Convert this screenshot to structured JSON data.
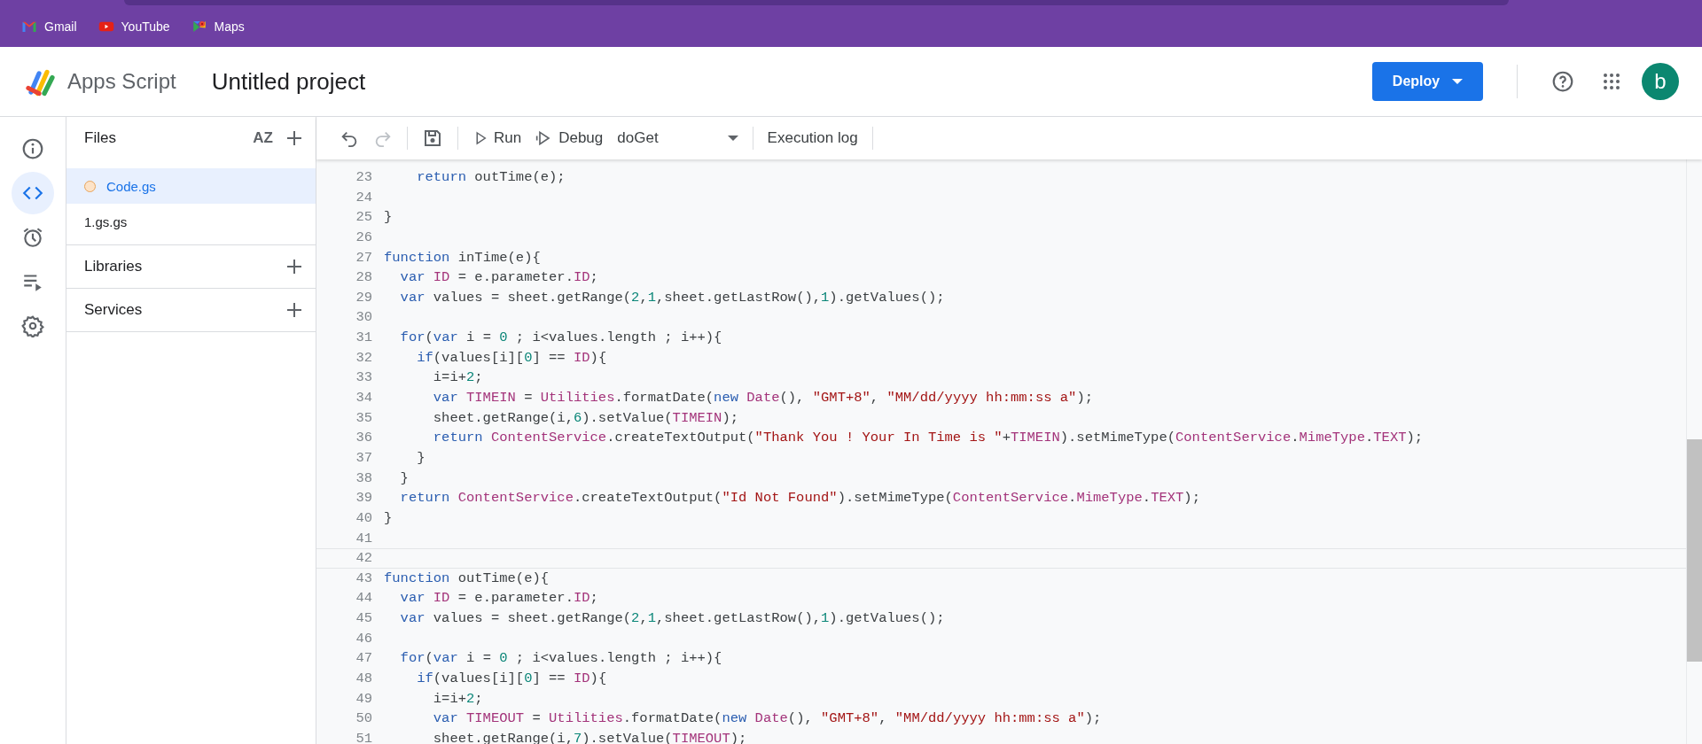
{
  "bookmarks": [
    {
      "kind": "gmail",
      "label": "Gmail"
    },
    {
      "kind": "youtube",
      "label": "YouTube"
    },
    {
      "kind": "maps",
      "label": "Maps"
    }
  ],
  "header": {
    "app_name": "Apps Script",
    "project_title": "Untitled project",
    "deploy_label": "Deploy",
    "avatar_letter": "b"
  },
  "rail": [
    {
      "kind": "info",
      "selected": false
    },
    {
      "kind": "editor",
      "selected": true
    },
    {
      "kind": "triggers",
      "selected": false
    },
    {
      "kind": "executions",
      "selected": false
    },
    {
      "kind": "settings",
      "selected": false
    }
  ],
  "files": {
    "title": "Files",
    "sort_label": "AZ",
    "items": [
      {
        "name": "Code.gs",
        "selected": true,
        "unsaved": true
      },
      {
        "name": "1.gs.gs",
        "selected": false,
        "unsaved": false
      }
    ]
  },
  "sections": [
    {
      "title": "Libraries"
    },
    {
      "title": "Services"
    }
  ],
  "toolbar": {
    "undo_disabled": false,
    "redo_disabled": true,
    "run_label": "Run",
    "debug_label": "Debug",
    "function_name": "doGet",
    "log_label": "Execution log"
  },
  "code_lines": [
    {
      "num": "23",
      "current": false,
      "tokens": [
        {
          "kind": "keyword",
          "text": "    return"
        },
        {
          "kind": "plain",
          "text": " outTime(e);"
        }
      ]
    },
    {
      "num": "24",
      "current": false
    },
    {
      "num": "25",
      "current": false,
      "tokens": [
        {
          "kind": "plain",
          "text": "}"
        }
      ]
    },
    {
      "num": "26",
      "current": false
    },
    {
      "num": "27",
      "current": false,
      "tokens": [
        {
          "kind": "keyword",
          "text": "function"
        },
        {
          "kind": "plain",
          "text": " inTime(e){"
        }
      ]
    },
    {
      "num": "28",
      "current": false,
      "tokens": [
        {
          "kind": "keyword",
          "text": "  var "
        },
        {
          "kind": "variable",
          "text": "ID"
        },
        {
          "kind": "plain",
          "text": " = e.parameter."
        },
        {
          "kind": "variable",
          "text": "ID"
        },
        {
          "kind": "plain",
          "text": ";"
        }
      ]
    },
    {
      "num": "29",
      "current": false,
      "tokens": [
        {
          "kind": "keyword",
          "text": "  var"
        },
        {
          "kind": "plain",
          "text": " values = sheet.getRange("
        },
        {
          "kind": "number",
          "text": "2"
        },
        {
          "kind": "plain",
          "text": ","
        },
        {
          "kind": "number",
          "text": "1"
        },
        {
          "kind": "plain",
          "text": ",sheet.getLastRow(),"
        },
        {
          "kind": "number",
          "text": "1"
        },
        {
          "kind": "plain",
          "text": ").getValues();"
        }
      ]
    },
    {
      "num": "30",
      "current": false
    },
    {
      "num": "31",
      "current": false,
      "tokens": [
        {
          "kind": "keyword",
          "text": "  for"
        },
        {
          "kind": "plain",
          "text": "("
        },
        {
          "kind": "keyword",
          "text": "var"
        },
        {
          "kind": "plain",
          "text": " i = "
        },
        {
          "kind": "number",
          "text": "0"
        },
        {
          "kind": "plain",
          "text": " ; i<values.length ; i++){"
        }
      ]
    },
    {
      "num": "32",
      "current": false,
      "tokens": [
        {
          "kind": "keyword",
          "text": "    if"
        },
        {
          "kind": "plain",
          "text": "(values[i]["
        },
        {
          "kind": "number",
          "text": "0"
        },
        {
          "kind": "plain",
          "text": "] == "
        },
        {
          "kind": "variable",
          "text": "ID"
        },
        {
          "kind": "plain",
          "text": "){"
        }
      ]
    },
    {
      "num": "33",
      "current": false,
      "tokens": [
        {
          "kind": "plain",
          "text": "      i=i+"
        },
        {
          "kind": "number",
          "text": "2"
        },
        {
          "kind": "plain",
          "text": ";"
        }
      ]
    },
    {
      "num": "34",
      "current": false,
      "tokens": [
        {
          "kind": "keyword",
          "text": "      var "
        },
        {
          "kind": "variable",
          "text": "TIMEIN"
        },
        {
          "kind": "plain",
          "text": " = "
        },
        {
          "kind": "variable",
          "text": "Utilities"
        },
        {
          "kind": "plain",
          "text": ".formatDate("
        },
        {
          "kind": "keyword",
          "text": "new "
        },
        {
          "kind": "variable",
          "text": "Date"
        },
        {
          "kind": "plain",
          "text": "(), "
        },
        {
          "kind": "string",
          "text": "\"GMT+8\""
        },
        {
          "kind": "plain",
          "text": ", "
        },
        {
          "kind": "string",
          "text": "\"MM/dd/yyyy hh:mm:ss a\""
        },
        {
          "kind": "plain",
          "text": ");"
        }
      ]
    },
    {
      "num": "35",
      "current": false,
      "tokens": [
        {
          "kind": "plain",
          "text": "      sheet.getRange(i,"
        },
        {
          "kind": "number",
          "text": "6"
        },
        {
          "kind": "plain",
          "text": ").setValue("
        },
        {
          "kind": "variable",
          "text": "TIMEIN"
        },
        {
          "kind": "plain",
          "text": ");"
        }
      ]
    },
    {
      "num": "36",
      "current": false,
      "tokens": [
        {
          "kind": "keyword",
          "text": "      return "
        },
        {
          "kind": "variable",
          "text": "ContentService"
        },
        {
          "kind": "plain",
          "text": ".createTextOutput("
        },
        {
          "kind": "string",
          "text": "\"Thank You ! Your In Time is \""
        },
        {
          "kind": "plain",
          "text": "+"
        },
        {
          "kind": "variable",
          "text": "TIMEIN"
        },
        {
          "kind": "plain",
          "text": ").setMimeType("
        },
        {
          "kind": "variable",
          "text": "ContentService"
        },
        {
          "kind": "plain",
          "text": "."
        },
        {
          "kind": "variable",
          "text": "MimeType"
        },
        {
          "kind": "plain",
          "text": "."
        },
        {
          "kind": "variable",
          "text": "TEXT"
        },
        {
          "kind": "plain",
          "text": ");"
        }
      ]
    },
    {
      "num": "37",
      "current": false,
      "tokens": [
        {
          "kind": "plain",
          "text": "    }"
        }
      ]
    },
    {
      "num": "38",
      "current": false,
      "tokens": [
        {
          "kind": "plain",
          "text": "  }"
        }
      ]
    },
    {
      "num": "39",
      "current": false,
      "tokens": [
        {
          "kind": "keyword",
          "text": "  return "
        },
        {
          "kind": "variable",
          "text": "ContentService"
        },
        {
          "kind": "plain",
          "text": ".createTextOutput("
        },
        {
          "kind": "string",
          "text": "\"Id Not Found\""
        },
        {
          "kind": "plain",
          "text": ").setMimeType("
        },
        {
          "kind": "variable",
          "text": "ContentService"
        },
        {
          "kind": "plain",
          "text": "."
        },
        {
          "kind": "variable",
          "text": "MimeType"
        },
        {
          "kind": "plain",
          "text": "."
        },
        {
          "kind": "variable",
          "text": "TEXT"
        },
        {
          "kind": "plain",
          "text": ");"
        }
      ]
    },
    {
      "num": "40",
      "current": false,
      "tokens": [
        {
          "kind": "plain",
          "text": "}"
        }
      ]
    },
    {
      "num": "41",
      "current": false
    },
    {
      "num": "42",
      "current": true
    },
    {
      "num": "43",
      "current": false,
      "tokens": [
        {
          "kind": "keyword",
          "text": "function"
        },
        {
          "kind": "plain",
          "text": " outTime(e){"
        }
      ]
    },
    {
      "num": "44",
      "current": false,
      "tokens": [
        {
          "kind": "keyword",
          "text": "  var "
        },
        {
          "kind": "variable",
          "text": "ID"
        },
        {
          "kind": "plain",
          "text": " = e.parameter."
        },
        {
          "kind": "variable",
          "text": "ID"
        },
        {
          "kind": "plain",
          "text": ";"
        }
      ]
    },
    {
      "num": "45",
      "current": false,
      "tokens": [
        {
          "kind": "keyword",
          "text": "  var"
        },
        {
          "kind": "plain",
          "text": " values = sheet.getRange("
        },
        {
          "kind": "number",
          "text": "2"
        },
        {
          "kind": "plain",
          "text": ","
        },
        {
          "kind": "number",
          "text": "1"
        },
        {
          "kind": "plain",
          "text": ",sheet.getLastRow(),"
        },
        {
          "kind": "number",
          "text": "1"
        },
        {
          "kind": "plain",
          "text": ").getValues();"
        }
      ]
    },
    {
      "num": "46",
      "current": false
    },
    {
      "num": "47",
      "current": false,
      "tokens": [
        {
          "kind": "keyword",
          "text": "  for"
        },
        {
          "kind": "plain",
          "text": "("
        },
        {
          "kind": "keyword",
          "text": "var"
        },
        {
          "kind": "plain",
          "text": " i = "
        },
        {
          "kind": "number",
          "text": "0"
        },
        {
          "kind": "plain",
          "text": " ; i<values.length ; i++){"
        }
      ]
    },
    {
      "num": "48",
      "current": false,
      "tokens": [
        {
          "kind": "keyword",
          "text": "    if"
        },
        {
          "kind": "plain",
          "text": "(values[i]["
        },
        {
          "kind": "number",
          "text": "0"
        },
        {
          "kind": "plain",
          "text": "] == "
        },
        {
          "kind": "variable",
          "text": "ID"
        },
        {
          "kind": "plain",
          "text": "){"
        }
      ]
    },
    {
      "num": "49",
      "current": false,
      "tokens": [
        {
          "kind": "plain",
          "text": "      i=i+"
        },
        {
          "kind": "number",
          "text": "2"
        },
        {
          "kind": "plain",
          "text": ";"
        }
      ]
    },
    {
      "num": "50",
      "current": false,
      "tokens": [
        {
          "kind": "keyword",
          "text": "      var "
        },
        {
          "kind": "variable",
          "text": "TIMEOUT"
        },
        {
          "kind": "plain",
          "text": " = "
        },
        {
          "kind": "variable",
          "text": "Utilities"
        },
        {
          "kind": "plain",
          "text": ".formatDate("
        },
        {
          "kind": "keyword",
          "text": "new "
        },
        {
          "kind": "variable",
          "text": "Date"
        },
        {
          "kind": "plain",
          "text": "(), "
        },
        {
          "kind": "string",
          "text": "\"GMT+8\""
        },
        {
          "kind": "plain",
          "text": ", "
        },
        {
          "kind": "string",
          "text": "\"MM/dd/yyyy hh:mm:ss a\""
        },
        {
          "kind": "plain",
          "text": ");"
        }
      ]
    },
    {
      "num": "51",
      "current": false,
      "tokens": [
        {
          "kind": "plain",
          "text": "      sheet.getRange(i,"
        },
        {
          "kind": "number",
          "text": "7"
        },
        {
          "kind": "plain",
          "text": ").setValue("
        },
        {
          "kind": "variable",
          "text": "TIMEOUT"
        },
        {
          "kind": "plain",
          "text": ");"
        }
      ]
    }
  ]
}
